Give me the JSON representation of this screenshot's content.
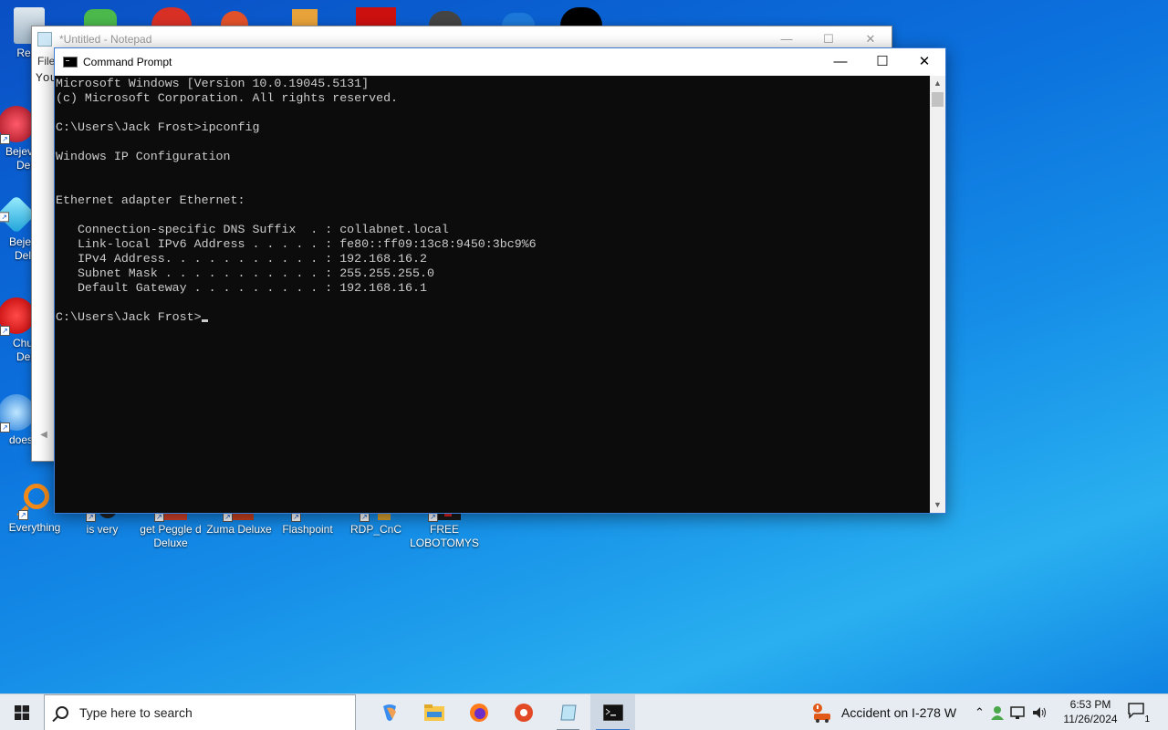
{
  "desktop_icons": [
    {
      "label": "Recy",
      "icon": "recycle-bin-icon"
    },
    {
      "label": "Bejev\nDel",
      "icon": "bejeweled-icon"
    },
    {
      "label": "Beje\nDel",
      "icon": "bejeweled-deluxe-icon"
    },
    {
      "label": "Chu\nDel",
      "icon": "chuzzle-icon"
    },
    {
      "label": "does",
      "icon": "ie-icon"
    },
    {
      "label": "Everything",
      "icon": "everything-search-icon"
    },
    {
      "label": "is very",
      "icon": "shortcut-icon"
    },
    {
      "label": "get Peggle d\nDeluxe",
      "icon": "peggle-icon"
    },
    {
      "label": "Zuma Deluxe",
      "icon": "zuma-icon"
    },
    {
      "label": "Flashpoint",
      "icon": "flashpoint-icon"
    },
    {
      "label": "RDP_CnC",
      "icon": "rdp-icon"
    },
    {
      "label": "FREE\nLOBOTOMYS",
      "icon": "shortcut-icon"
    }
  ],
  "notepad": {
    "title": "*Untitled - Notepad",
    "menu_first": "File",
    "body_text": "You"
  },
  "cmd": {
    "title": "Command Prompt",
    "lines": [
      "Microsoft Windows [Version 10.0.19045.5131]",
      "(c) Microsoft Corporation. All rights reserved.",
      "",
      "C:\\Users\\Jack Frost>ipconfig",
      "",
      "Windows IP Configuration",
      "",
      "",
      "Ethernet adapter Ethernet:",
      "",
      "   Connection-specific DNS Suffix  . : collabnet.local",
      "   Link-local IPv6 Address . . . . . : fe80::ff09:13c8:9450:3bc9%6",
      "   IPv4 Address. . . . . . . . . . . : 192.168.16.2",
      "   Subnet Mask . . . . . . . . . . . : 255.255.255.0",
      "   Default Gateway . . . . . . . . . : 192.168.16.1",
      ""
    ],
    "prompt": "C:\\Users\\Jack Frost>"
  },
  "taskbar": {
    "search_placeholder": "Type here to search",
    "apps": [
      "copilot-icon",
      "file-explorer-icon",
      "firefox-icon",
      "brave-icon",
      "notepad-icon",
      "command-prompt-icon"
    ],
    "weather_text": "Accident on I-278 W",
    "time": "6:53 PM",
    "date": "11/26/2024",
    "notification_count": "1"
  },
  "colors": {
    "console_bg": "#0c0c0c",
    "console_fg": "#cccccc",
    "taskbar_bg": "#e6ecf2"
  }
}
